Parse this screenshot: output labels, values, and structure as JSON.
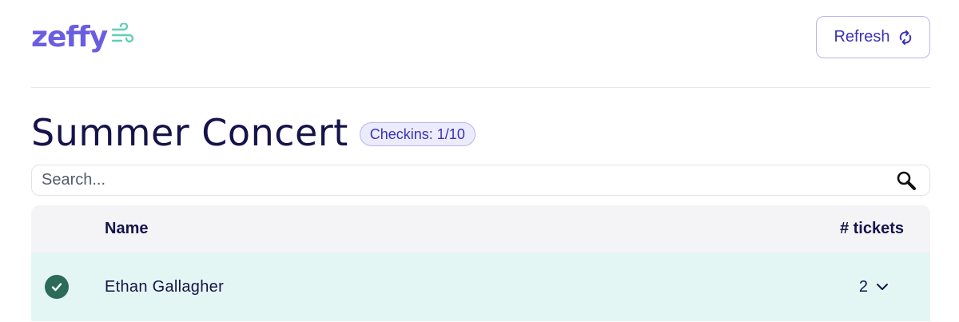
{
  "brand": {
    "name": "zeffy",
    "primary_color": "#6a5ee0",
    "accent_color": "#5fd0b6"
  },
  "header": {
    "refresh_label": "Refresh",
    "refresh_icon": "refresh-icon"
  },
  "event": {
    "title": "Summer Concert",
    "checkins_badge": "Checkins: 1/10"
  },
  "search": {
    "placeholder": "Search...",
    "value": "",
    "icon": "search-icon"
  },
  "table": {
    "columns": {
      "status": "",
      "name": "Name",
      "tickets": "# tickets"
    },
    "rows": [
      {
        "checked_in": true,
        "name": "Ethan Gallagher",
        "tickets": "2"
      }
    ]
  },
  "colors": {
    "row_checked_bg": "#e4f6f3",
    "check_green": "#2b6b57",
    "header_bg": "#f4f4f7"
  }
}
